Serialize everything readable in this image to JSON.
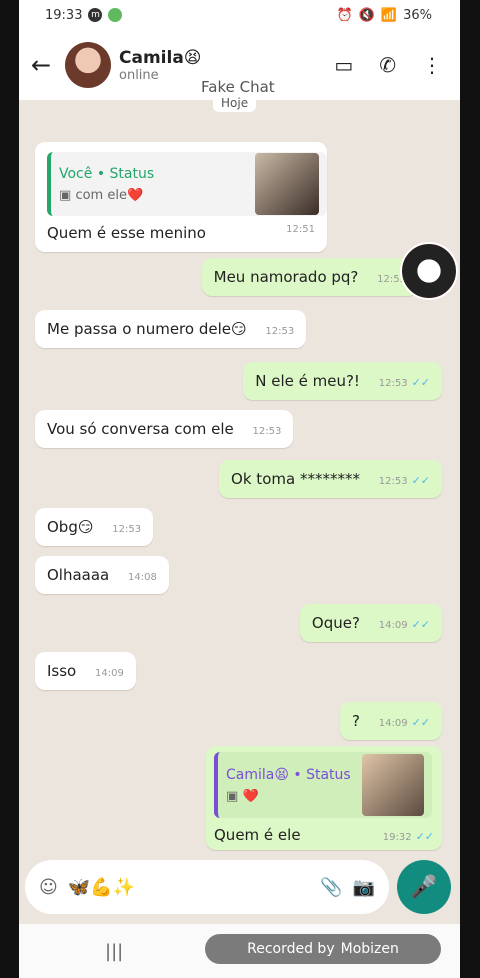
{
  "statusbar": {
    "time": "19:33",
    "battery": "36%"
  },
  "header": {
    "contact_name": "Camila😫",
    "contact_status": "online"
  },
  "watermark": "Fake Chat",
  "date_chip": "Hoje",
  "messages": [
    {
      "dir": "in",
      "reply": {
        "title": "Você • Status",
        "subtitle": "com ele❤️"
      },
      "text": "Quem é esse menino",
      "time": "12:51"
    },
    {
      "dir": "out",
      "text": "Meu namorado pq?",
      "time": "12:53"
    },
    {
      "dir": "in",
      "text": "Me passa o numero dele😏",
      "time": "12:53"
    },
    {
      "dir": "out",
      "text": "N ele é meu?!",
      "time": "12:53"
    },
    {
      "dir": "in",
      "text": "Vou só conversa com ele",
      "time": "12:53"
    },
    {
      "dir": "out",
      "text": "Ok toma ********",
      "time": "12:53"
    },
    {
      "dir": "in",
      "text": "Obg😏",
      "time": "12:53"
    },
    {
      "dir": "in",
      "text": "Olhaaaa",
      "time": "14:08"
    },
    {
      "dir": "out",
      "text": "Oque?",
      "time": "14:09"
    },
    {
      "dir": "in",
      "text": "Isso",
      "time": "14:09"
    },
    {
      "dir": "out",
      "text": "?",
      "time": "14:09"
    },
    {
      "dir": "out",
      "reply": {
        "title": "Camila😫 • Status",
        "subtitle": "❤️"
      },
      "text": "Quem é ele",
      "time": "19:32"
    }
  ],
  "composer": {
    "emoji_chips": "🦋💪✨"
  },
  "recorder": {
    "label": "Recorded by",
    "brand": "Mobizen"
  }
}
